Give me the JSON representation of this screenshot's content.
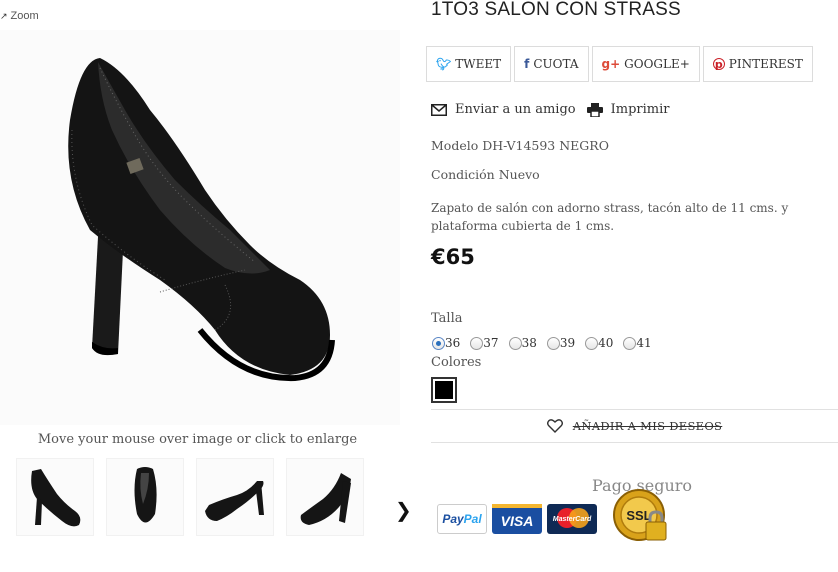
{
  "zoom_label": "Zoom",
  "image_hint": "Move your mouse over image or click to enlarge",
  "product": {
    "title": "1TO3 SALON CON STRASS",
    "modelo_label": "Modelo",
    "modelo_value": "DH-V14593 NEGRO",
    "condicion_label": "Condición",
    "condicion_value": "Nuevo",
    "description": "Zapato de salón con adorno strass, tacón alto de 11 cms. y plataforma cubierta de 1 cms.",
    "price": "€65"
  },
  "share": {
    "tweet": "TWEET",
    "cuota": "CUOTA",
    "google": "GOOGLE+",
    "pinterest": "PINTEREST"
  },
  "actions": {
    "send_friend": "Enviar a un amigo",
    "print": "Imprimir"
  },
  "talla": {
    "label": "Talla",
    "options": [
      "36",
      "37",
      "38",
      "39",
      "40",
      "41"
    ],
    "selected": "36"
  },
  "colores": {
    "label": "Colores",
    "selected_color": "#000000"
  },
  "wishlist_label": "AÑADIR A MIS DESEOS",
  "pago_label": "Pago seguro",
  "cards": {
    "paypal_a": "Pay",
    "paypal_b": "Pal",
    "visa": "VISA",
    "mastercard": "MasterCard",
    "ssl": "SSL"
  },
  "icons": {
    "zoom": "magnifier-icon",
    "twitter": "twitter-icon",
    "facebook": "facebook-icon",
    "google": "google-plus-icon",
    "pinterest": "pinterest-icon",
    "envelope": "envelope-icon",
    "printer": "printer-icon",
    "heart": "heart-icon",
    "next": "chevron-right-icon",
    "lock": "padlock-icon"
  }
}
